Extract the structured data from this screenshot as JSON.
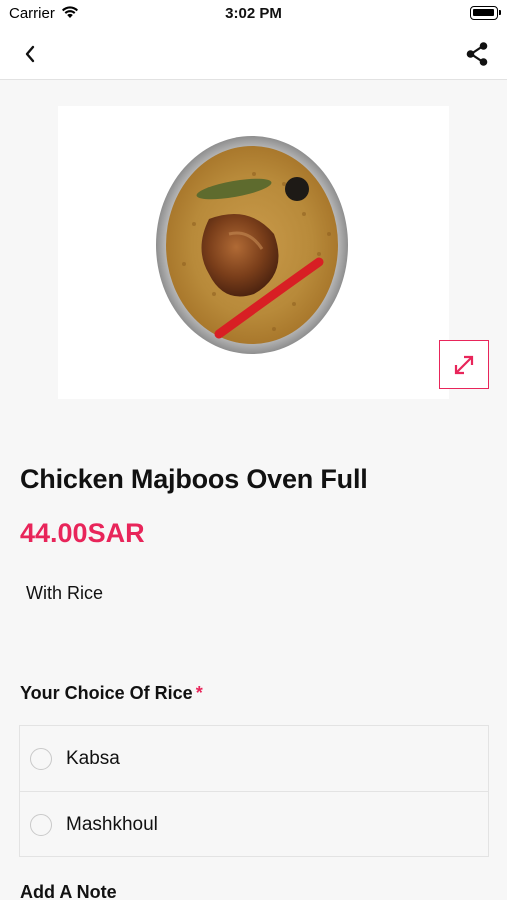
{
  "status_bar": {
    "carrier": "Carrier",
    "time": "3:02 PM"
  },
  "nav": {
    "back_icon": "chevron-left-icon",
    "share_icon": "share-icon"
  },
  "product": {
    "image_alt": "Chicken Majboos Oven Full",
    "expand_icon": "expand-icon",
    "name": "Chicken Majboos Oven Full",
    "price": "44.00SAR",
    "description": "With Rice"
  },
  "rice_choice": {
    "title": "Your Choice Of Rice",
    "required_mark": "*",
    "options": [
      {
        "label": "Kabsa",
        "selected": false
      },
      {
        "label": "Mashkhoul",
        "selected": false
      }
    ]
  },
  "note": {
    "title": "Add A Note"
  },
  "colors": {
    "accent": "#e8255a",
    "background": "#f7f7f7"
  }
}
